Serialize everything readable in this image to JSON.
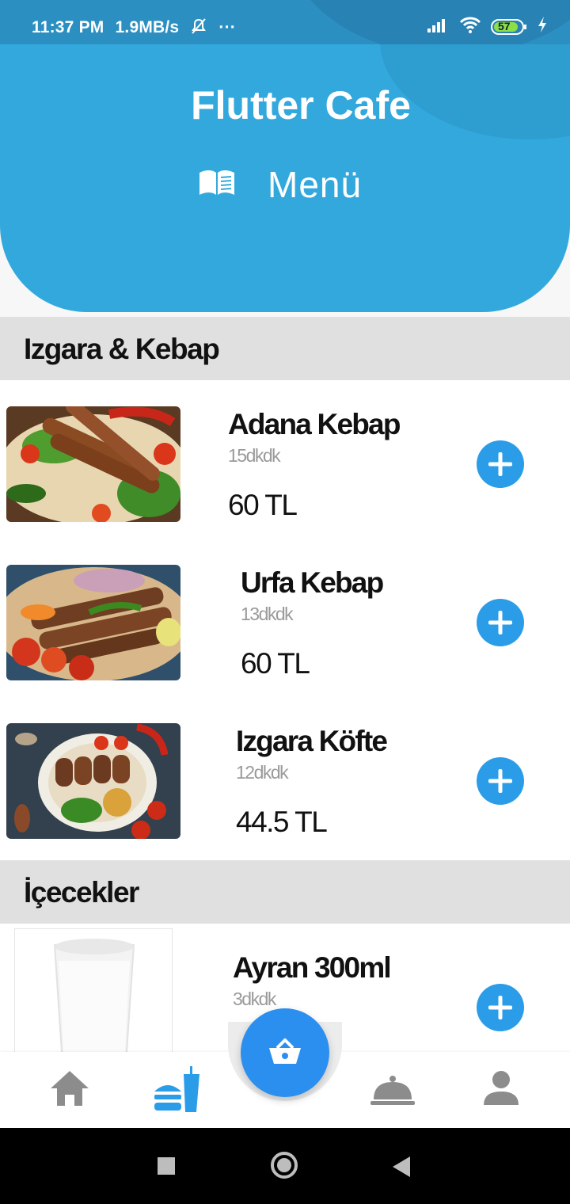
{
  "status_bar": {
    "time": "11:37 PM",
    "speed": "1.9MB/s",
    "more": "···",
    "battery": "57"
  },
  "header": {
    "title": "Flutter Cafe",
    "menu_label": "Menü",
    "menu_icon": "book-icon",
    "background_color": "#33a8dd"
  },
  "sections": [
    {
      "title": "Izgara & Kebap",
      "items": [
        {
          "name": "Adana Kebap",
          "time": "15dkdk",
          "price": "60 TL",
          "image": "adana-kebap-photo"
        },
        {
          "name": "Urfa Kebap",
          "time": "13dkdk",
          "price": "60 TL",
          "image": "urfa-kebap-photo"
        },
        {
          "name": "Izgara Köfte",
          "time": "12dkdk",
          "price": "44.5 TL",
          "image": "izgara-kofte-photo"
        }
      ]
    },
    {
      "title": "İçecekler",
      "items": [
        {
          "name": "Ayran 300ml",
          "time": "3dkdk",
          "image": "ayran-photo"
        }
      ]
    }
  ],
  "bottom_nav": {
    "items": [
      "home-icon",
      "fastfood-icon",
      "basket-icon",
      "room-service-icon",
      "person-icon"
    ],
    "active": "fastfood-icon",
    "active_color": "#2b9de8",
    "inactive_color": "#8c8c8c"
  },
  "accent_color": "#2b9de8"
}
